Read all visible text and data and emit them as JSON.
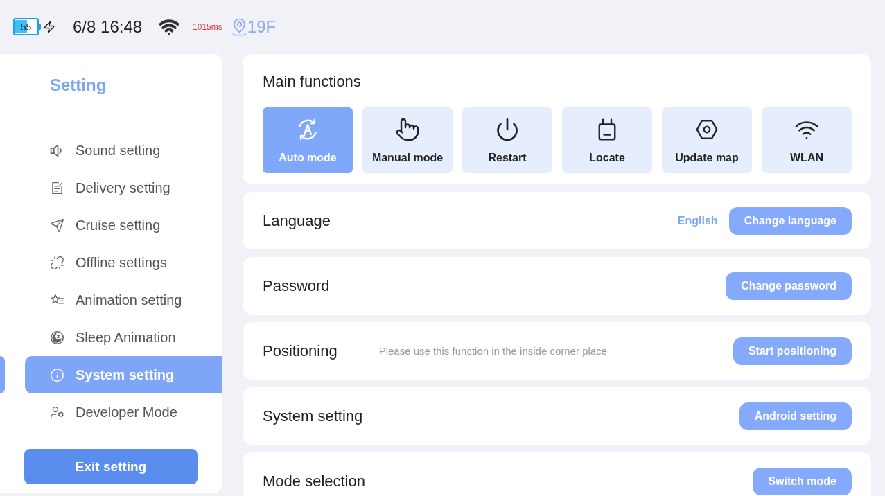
{
  "status_bar": {
    "battery": {
      "reading": "55",
      "level": 0.55,
      "charging": true
    },
    "time": "6/8 16:48",
    "latency": "1015ms",
    "floor": "19F"
  },
  "sidebar": {
    "title": "Setting",
    "items": [
      {
        "label": "Sound setting",
        "selected": false
      },
      {
        "label": "Delivery setting",
        "selected": false
      },
      {
        "label": "Cruise setting",
        "selected": false
      },
      {
        "label": "Offline settings",
        "selected": false
      },
      {
        "label": "Animation setting",
        "selected": false
      },
      {
        "label": "Sleep Animation",
        "selected": false
      },
      {
        "label": "System setting",
        "selected": true
      },
      {
        "label": "Developer Mode",
        "selected": false
      }
    ],
    "exit_button": "Exit setting"
  },
  "main_functions": {
    "title": "Main functions",
    "tiles": [
      {
        "label": "Auto mode",
        "selected": true
      },
      {
        "label": "Manual mode",
        "selected": false
      },
      {
        "label": "Restart",
        "selected": false
      },
      {
        "label": "Locate",
        "selected": false
      },
      {
        "label": "Update map",
        "selected": false
      },
      {
        "label": "WLAN",
        "selected": false
      }
    ]
  },
  "settings": [
    {
      "title": "Language",
      "value": "English",
      "button": "Change language"
    },
    {
      "title": "Password",
      "button": "Change password"
    },
    {
      "title": "Positioning",
      "note": "Please use this function in the inside corner place",
      "button": "Start positioning"
    },
    {
      "title": "System setting",
      "button": "Android setting"
    },
    {
      "title": "Mode selection",
      "button": "Switch mode"
    }
  ]
}
